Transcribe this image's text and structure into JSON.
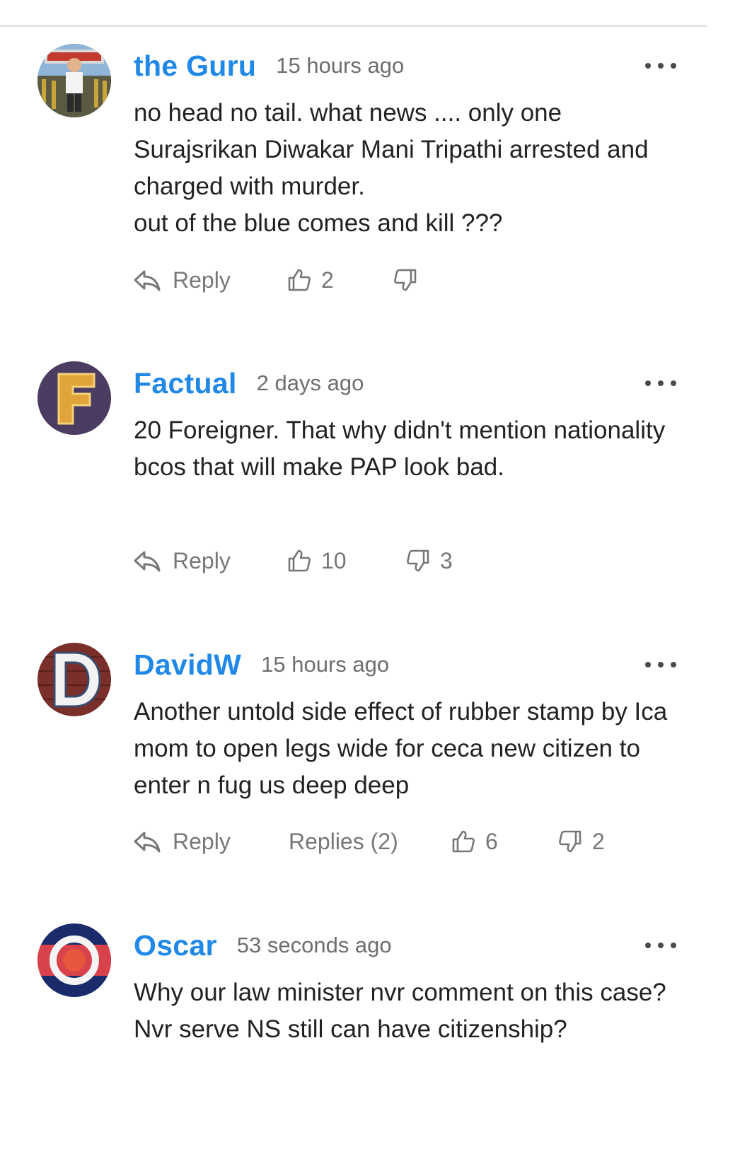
{
  "comments": [
    {
      "author": "the Guru",
      "time": "15 hours ago",
      "text": "no head no tail. what news .... only one Surajsrikan Diwakar Mani Tripathi arrested and charged with murder.\nout of the blue comes and kill ???",
      "reply_label": "Reply",
      "likes": "2",
      "dislikes": "",
      "avatar": "photo-avatar"
    },
    {
      "author": "Factual",
      "time": "2 days ago",
      "text": "20 Foreigner. That why didn't mention nationality bcos that will make PAP look bad.",
      "reply_label": "Reply",
      "likes": "10",
      "dislikes": "3",
      "avatar": "letter-f-avatar"
    },
    {
      "author": "DavidW",
      "time": "15 hours ago",
      "text": "Another untold side effect of rubber stamp by Ica mom to open legs wide for ceca new citizen to enter n fug us deep deep",
      "reply_label": "Reply",
      "replies_label": "Replies (2)",
      "likes": "6",
      "dislikes": "2",
      "avatar": "letter-d-avatar"
    },
    {
      "author": "Oscar",
      "time": "53 seconds ago",
      "text": "Why our law minister nvr comment on this case? Nvr serve NS still can have citizenship?",
      "avatar": "ring-avatar"
    }
  ],
  "icons": {
    "reply": "reply-arrow-icon",
    "like": "thumbs-up-icon",
    "dislike": "thumbs-down-icon",
    "more": "more-dots-icon"
  },
  "colors": {
    "author": "#2088e6",
    "meta": "#6e6e6e",
    "action": "#777777"
  }
}
